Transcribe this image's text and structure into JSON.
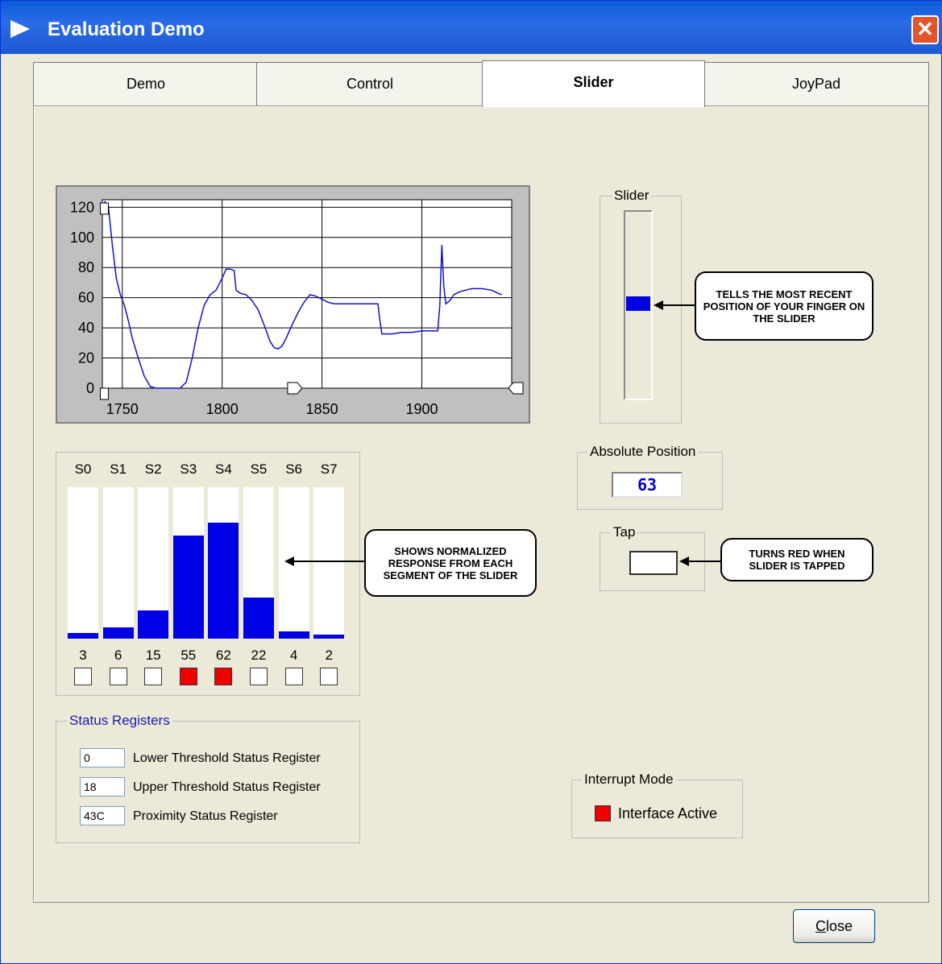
{
  "window": {
    "title": "Evaluation Demo",
    "close_glyph": "✕"
  },
  "tabs": [
    {
      "label": "Demo"
    },
    {
      "label": "Control"
    },
    {
      "label": "Slider"
    },
    {
      "label": "JoyPad"
    }
  ],
  "chart_data": {
    "type": "line",
    "x_ticks": [
      "1750",
      "1800",
      "1850",
      "1900"
    ],
    "y_ticks": [
      "0",
      "20",
      "40",
      "60",
      "80",
      "100",
      "120"
    ],
    "xlim": [
      1740,
      1945
    ],
    "ylim": [
      0,
      125
    ],
    "grid": true,
    "color": "#1010cc",
    "x": [
      1741,
      1743,
      1745,
      1747,
      1749,
      1751,
      1753,
      1755,
      1758,
      1761,
      1764,
      1767,
      1770,
      1773,
      1776,
      1779,
      1782,
      1785,
      1788,
      1791,
      1794,
      1797,
      1800,
      1802,
      1804,
      1806,
      1807,
      1809,
      1812,
      1815,
      1818,
      1821,
      1824,
      1826,
      1828,
      1830,
      1832,
      1835,
      1838,
      1841,
      1844,
      1847,
      1850,
      1853,
      1856,
      1860,
      1865,
      1870,
      1875,
      1878,
      1879,
      1880,
      1885,
      1890,
      1895,
      1900,
      1905,
      1908,
      1909,
      1910,
      1911,
      1912,
      1914,
      1916,
      1919,
      1922,
      1925,
      1930,
      1935,
      1938,
      1940
    ],
    "y": [
      124,
      121,
      95,
      73,
      62,
      55,
      45,
      33,
      20,
      8,
      1,
      0,
      0,
      0,
      0,
      0,
      4,
      20,
      40,
      55,
      62,
      65,
      73,
      79,
      79,
      78,
      65,
      63,
      62,
      58,
      52,
      42,
      31,
      27,
      26,
      28,
      33,
      42,
      50,
      57,
      62,
      61,
      59,
      57,
      56,
      56,
      56,
      56,
      56,
      56,
      45,
      36,
      36,
      37,
      37,
      38,
      38,
      38,
      55,
      95,
      68,
      56,
      58,
      62,
      64,
      65,
      66,
      66,
      65,
      63,
      62
    ]
  },
  "segments": {
    "labels": [
      "S0",
      "S1",
      "S2",
      "S3",
      "S4",
      "S5",
      "S6",
      "S7"
    ],
    "values": [
      3,
      6,
      15,
      55,
      62,
      22,
      4,
      2
    ],
    "values_text": [
      "3",
      "6",
      "15",
      "55",
      "62",
      "22",
      "4",
      "2"
    ],
    "max": 81,
    "touched": [
      false,
      false,
      false,
      true,
      true,
      false,
      false,
      false
    ],
    "bar_color": "#0000e6",
    "touch_color": "#ee0000"
  },
  "callouts": {
    "segments": "SHOWS NORMALIZED RESPONSE FROM EACH SEGMENT OF THE SLIDER",
    "slider": "TELLS THE MOST RECENT  POSITION OF YOUR FINGER ON THE SLIDER",
    "tap": "TURNS RED WHEN SLIDER IS TAPPED"
  },
  "status_registers": {
    "title": "Status Registers",
    "title_color": "#1a1ab0",
    "rows": [
      {
        "value": "0",
        "label": "Lower Threshold Status Register"
      },
      {
        "value": "18",
        "label": "Upper Threshold Status Register"
      },
      {
        "value": "43C",
        "label": "Proximity Status Register"
      }
    ]
  },
  "slider": {
    "title": "Slider",
    "position_percent": 51,
    "color": "#0000e6"
  },
  "absolute_position": {
    "title": "Absolute Position",
    "value": "63",
    "value_color": "#0000cc"
  },
  "tap": {
    "title": "Tap"
  },
  "interrupt_mode": {
    "title": "Interrupt Mode",
    "indicator_color": "#ee0000",
    "label": "Interface Active"
  },
  "close_button": {
    "label": "Close",
    "mnemonic": "C"
  }
}
